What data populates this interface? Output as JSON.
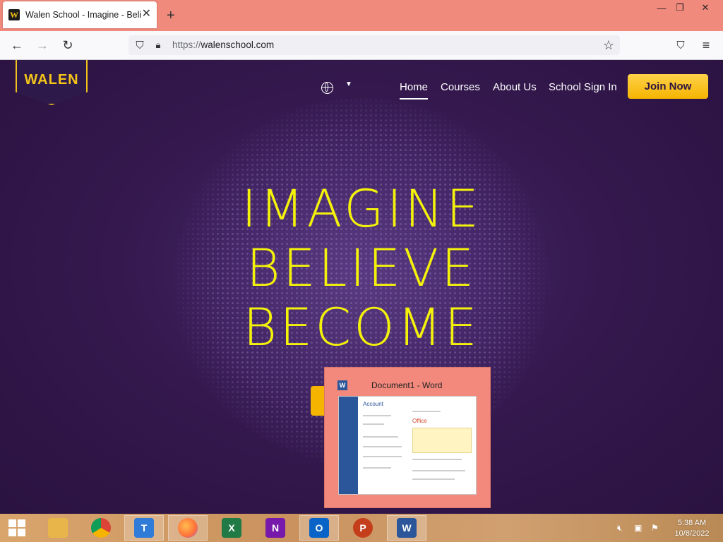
{
  "browser": {
    "tab_title": "Walen School - Imagine - Believ",
    "favicon_letter": "W",
    "url_protocol": "https://",
    "url_host": "walenschool.com"
  },
  "site": {
    "logo_text": "WALEN",
    "nav": [
      {
        "label": "Home"
      },
      {
        "label": "Courses"
      },
      {
        "label": "About Us"
      },
      {
        "label": "School Sign In"
      }
    ],
    "join_label": "Join Now",
    "hero_lines": [
      "IMAGINE",
      "BELIEVE",
      "BECOME"
    ]
  },
  "preview": {
    "title": "Document1 - Word",
    "app_letter": "W",
    "account_heading": "Account",
    "office_label": "Office"
  },
  "taskbar": {
    "apps": [
      {
        "name": "file-explorer",
        "color": "#e8b54a"
      },
      {
        "name": "chrome",
        "color": "#db4437"
      },
      {
        "name": "teams",
        "color": "#2f7bd8"
      },
      {
        "name": "firefox",
        "color": "#ff7139"
      },
      {
        "name": "excel",
        "color": "#1f7a45"
      },
      {
        "name": "onenote",
        "color": "#7719aa"
      },
      {
        "name": "outlook",
        "color": "#0a64c8"
      },
      {
        "name": "powerpoint",
        "color": "#c43e1c"
      },
      {
        "name": "word",
        "color": "#2b579a"
      }
    ],
    "time": "5:38 AM",
    "date": "10/8/2022"
  },
  "colors": {
    "hero_text": "#f4f20a",
    "accent_yellow": "#f5b400",
    "page_purple": "#35194f"
  }
}
